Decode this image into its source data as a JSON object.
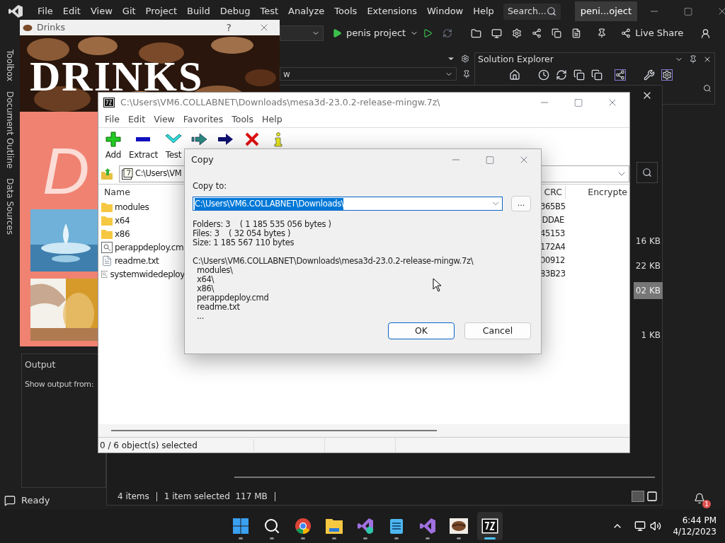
{
  "vs": {
    "menu": [
      "File",
      "Edit",
      "View",
      "Git",
      "Project",
      "Build",
      "Debug",
      "Test",
      "Analyze",
      "Tools",
      "Extensions",
      "Window",
      "Help"
    ],
    "search_placeholder": "Search...",
    "title": "peni...oject",
    "run_target": "penis project",
    "live_share": "Live Share",
    "dropdown_value": "w",
    "side_tabs": [
      "Toolbox",
      "Document Outline",
      "Data Sources"
    ],
    "solution_explorer": {
      "title": "Solution Explorer"
    },
    "output": {
      "title": "Output",
      "show_from": "Show output from:"
    },
    "status": "Ready",
    "notification_count": "1"
  },
  "explorer": {
    "sizes": [
      {
        "text": "16 KB",
        "selected": false
      },
      {
        "text": "22 KB",
        "selected": false
      },
      {
        "text": "02 KB",
        "selected": true
      },
      {
        "text": "1 KB",
        "selected": false
      }
    ],
    "item_count": "4 items",
    "selection": "1 item selected  117 MB"
  },
  "drinks_window": {
    "title": "Drinks",
    "help": "?",
    "heading": "DRINKS",
    "letter": "D"
  },
  "archive_window": {
    "title": "C:\\Users\\VM6.COLLABNET\\Downloads\\mesa3d-23.0.2-release-mingw.7z\\",
    "menu": [
      "File",
      "Edit",
      "View",
      "Favorites",
      "Tools",
      "Help"
    ],
    "toolbar": [
      {
        "kind": "add",
        "label": "Add"
      },
      {
        "kind": "extract",
        "label": "Extract"
      },
      {
        "kind": "test",
        "label": "Test"
      },
      {
        "kind": "copy"
      },
      {
        "kind": "move"
      },
      {
        "kind": "delete"
      },
      {
        "kind": "info"
      }
    ],
    "path": "C:\\Users\\VM",
    "columns": [
      "Name",
      "CRC",
      "Encrypte"
    ],
    "rows": [
      {
        "kind": "folder",
        "name": "modules",
        "crc": "365B5"
      },
      {
        "kind": "folder",
        "name": "x64",
        "crc": "DDAE"
      },
      {
        "kind": "folder",
        "name": "x86",
        "crc": "45153"
      },
      {
        "kind": "script",
        "name": "perappdeploy.cm",
        "crc": "172A4"
      },
      {
        "kind": "text",
        "name": "readme.txt",
        "crc": "00912"
      },
      {
        "kind": "script",
        "name": "systemwidedeploy",
        "crc": "83B23"
      }
    ],
    "status": "0 / 6 object(s) selected"
  },
  "copy_dialog": {
    "title": "Copy",
    "label": "Copy to:",
    "value": "C:\\Users\\VM6.COLLABNET\\Downloads\\",
    "value_highlighted": true,
    "browse": "...",
    "summary": [
      "Folders: 3    ( 1 185 535 056 bytes )",
      "Files: 3    ( 32 054 bytes )",
      "Size: 1 185 567 110 bytes"
    ],
    "source": "C:\\Users\\VM6.COLLABNET\\Downloads\\mesa3d-23.0.2-release-mingw.7z\\",
    "items": [
      "modules\\",
      "x64\\",
      "x86\\",
      "perappdeploy.cmd",
      "readme.txt",
      "..."
    ],
    "ok": "OK",
    "cancel": "Cancel"
  },
  "taskbar": {
    "apps": [
      {
        "kind": "start",
        "selected": false
      },
      {
        "kind": "search",
        "selected": false
      },
      {
        "kind": "browser",
        "selected": false
      },
      {
        "kind": "files",
        "selected": false
      },
      {
        "kind": "vs-installer",
        "selected": false
      },
      {
        "kind": "notepad",
        "selected": false
      },
      {
        "kind": "vs",
        "selected": false
      },
      {
        "kind": "coffee",
        "selected": false
      },
      {
        "kind": "archiver",
        "selected": true
      }
    ],
    "time": "6:44 PM",
    "date": "4/12/2023"
  }
}
